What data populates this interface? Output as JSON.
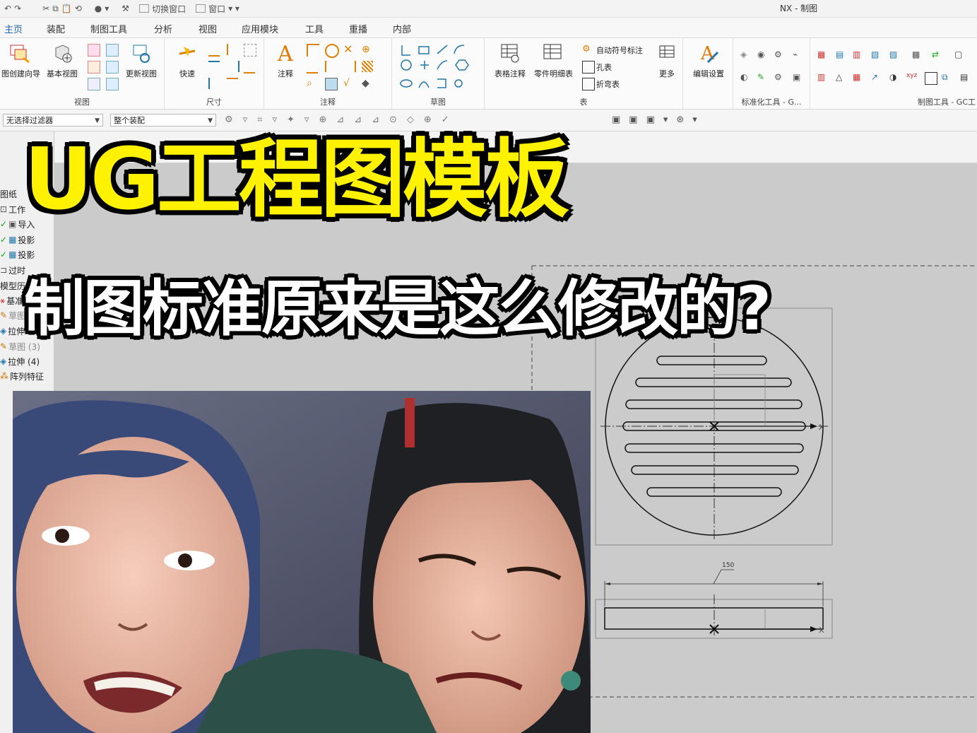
{
  "window": {
    "title": "NX - 制图"
  },
  "quick_access": {
    "switch_window": "切换窗口",
    "window": "窗口"
  },
  "tabs": [
    "主页",
    "装配",
    "制图工具",
    "分析",
    "视图",
    "应用模块",
    "工具",
    "重播",
    "内部"
  ],
  "ribbon": {
    "view_group": {
      "label": "视图",
      "buttons": [
        "图创建向导",
        "基本视图",
        "更新视图"
      ]
    },
    "dimension_group": {
      "label": "尺寸",
      "buttons": [
        "快速"
      ]
    },
    "annotation_group": {
      "label": "注释",
      "buttons": [
        "注释"
      ]
    },
    "sketch_group": {
      "label": "草图"
    },
    "table_group": {
      "label": "表",
      "buttons": [
        "表格注释",
        "零件明细表"
      ],
      "small_items": [
        "自动符号标注",
        "孔表",
        "折弯表"
      ],
      "more": "更多"
    },
    "edit_settings": "编辑设置",
    "std_tools": "标准化工具 - G...",
    "drafting_tools": "制图工具 - GC工"
  },
  "filterbar": {
    "filter": "无选择过滤器",
    "scope": "整个装配"
  },
  "navigator": {
    "items": [
      "图纸",
      "工作",
      "导入",
      "投影",
      "投影",
      "过时",
      "模型历史",
      "基准",
      "草图",
      "拉伸",
      "草图 (3)",
      "拉伸 (4)",
      "阵列特征"
    ]
  },
  "drawing": {
    "dimension_value": "150",
    "axis_x": "X"
  },
  "overlay": {
    "headline": "UG工程图模板",
    "subline": "制图标准原来是这么修改的?"
  },
  "colors": {
    "headline": "#fff200",
    "accent": "#1f66b3"
  }
}
